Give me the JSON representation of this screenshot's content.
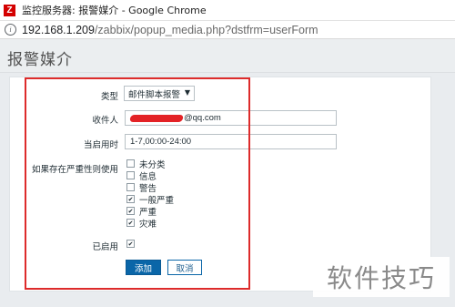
{
  "browser": {
    "title": "监控服务器: 报警媒介 - Google Chrome",
    "url_host": "192.168.1.209",
    "url_path": "/zabbix/popup_media.php?dstfrm=userForm"
  },
  "page": {
    "title": "报警媒介"
  },
  "form": {
    "type_label": "类型",
    "type_value": "邮件脚本报警",
    "recipient_label": "收件人",
    "recipient_value": "@qq.com",
    "when_active_label": "当启用时",
    "when_active_value": "1-7,00:00-24:00",
    "severity_label": "如果存在严重性则使用",
    "severities": [
      {
        "label": "未分类",
        "checked": false
      },
      {
        "label": "信息",
        "checked": false
      },
      {
        "label": "警告",
        "checked": false
      },
      {
        "label": "一般严重",
        "checked": true
      },
      {
        "label": "严重",
        "checked": true
      },
      {
        "label": "灾难",
        "checked": true
      }
    ],
    "enabled_label": "已启用",
    "enabled": true,
    "add_label": "添加",
    "cancel_label": "取消"
  },
  "watermark": "软件技巧",
  "colors": {
    "accent": "#0a66a8",
    "highlight": "#dd2b2b",
    "brand": "#d40000"
  }
}
